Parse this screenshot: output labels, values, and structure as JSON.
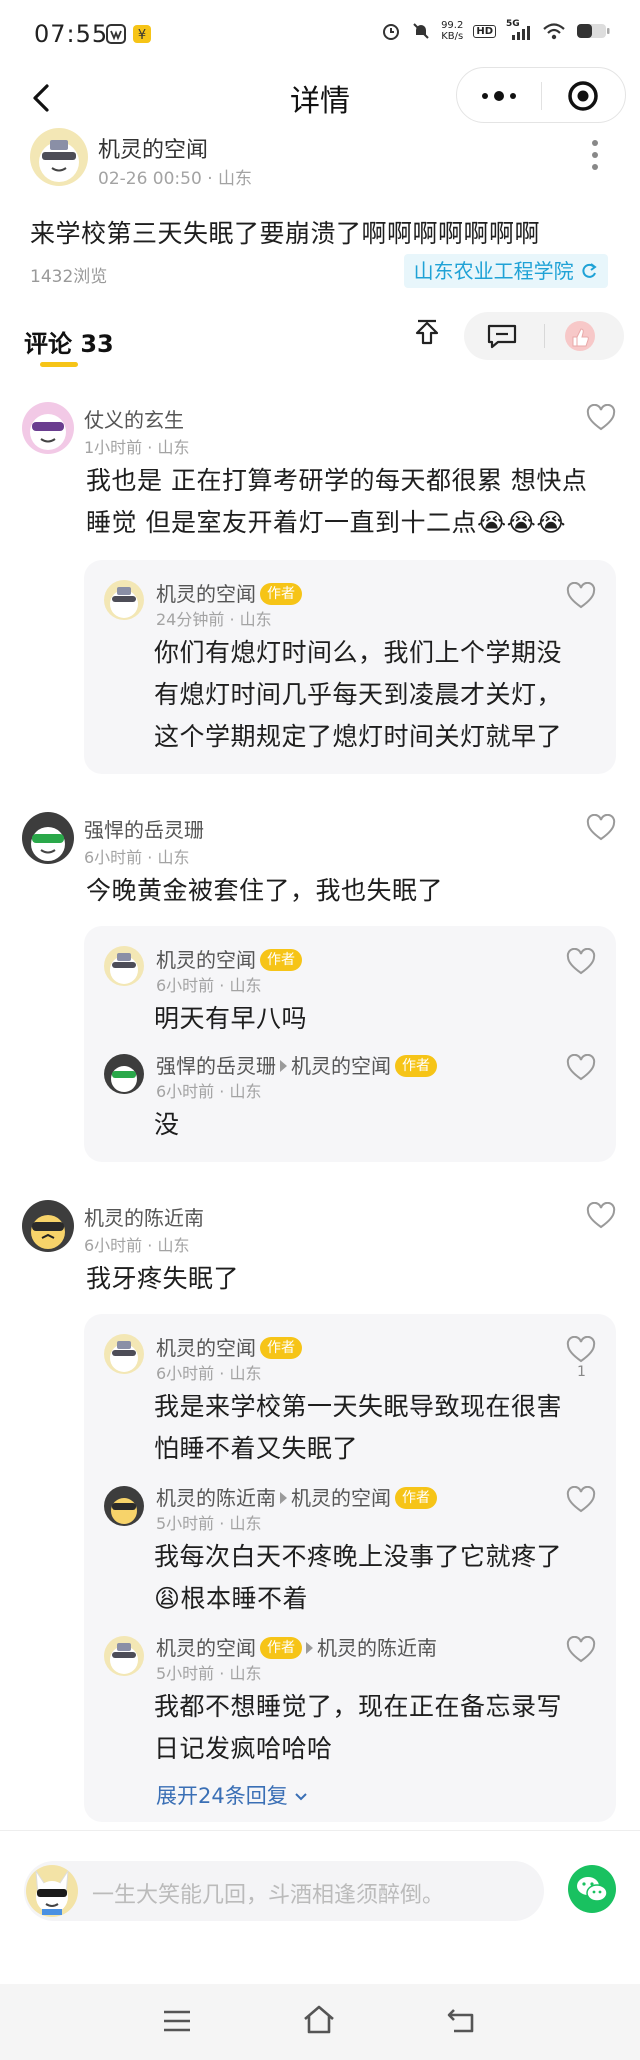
{
  "status_bar": {
    "time": "07:55",
    "net_speed_top": "99.2",
    "net_speed_bottom": "KB/s",
    "hd": "HD",
    "signal": "5G"
  },
  "nav": {
    "title": "详情"
  },
  "post": {
    "author": "机灵的空闻",
    "time": "02-26 00:50",
    "location": "山东",
    "content": "来学校第三天失眠了要崩溃了啊啊啊啊啊啊啊",
    "views": "1432浏览",
    "school_tag": "山东农业工程学院"
  },
  "comments_header": {
    "title": "评论 33"
  },
  "comments": [
    {
      "author": "仗义的玄生",
      "time": "1小时前",
      "location": "山东",
      "lines": [
        "我也是 正在打算考研学的每天都很累 想快点",
        "睡觉 但是室友开着灯一直到十二点😭😭😭"
      ],
      "replies": [
        {
          "author": "机灵的空闻",
          "badge": "作者",
          "time": "24分钟前",
          "location": "山东",
          "lines": [
            "你们有熄灯时间么，我们上个学期没",
            "有熄灯时间几乎每天到凌晨才关灯，",
            "这个学期规定了熄灯时间关灯就早了"
          ]
        }
      ]
    },
    {
      "author": "强悍的岳灵珊",
      "time": "6小时前",
      "location": "山东",
      "lines": [
        "今晚黄金被套住了，我也失眠了"
      ],
      "replies": [
        {
          "author": "机灵的空闻",
          "badge": "作者",
          "time": "6小时前",
          "location": "山东",
          "lines": [
            "明天有早八吗"
          ]
        },
        {
          "author": "强悍的岳灵珊",
          "reply_to": "机灵的空闻",
          "reply_to_badge": "作者",
          "time": "6小时前",
          "location": "山东",
          "lines": [
            "没"
          ]
        }
      ]
    },
    {
      "author": "机灵的陈近南",
      "time": "6小时前",
      "location": "山东",
      "lines": [
        "我牙疼失眠了"
      ],
      "replies": [
        {
          "author": "机灵的空闻",
          "badge": "作者",
          "time": "6小时前",
          "location": "山东",
          "like_count": "1",
          "lines": [
            "我是来学校第一天失眠导致现在很害",
            "怕睡不着又失眠了"
          ]
        },
        {
          "author": "机灵的陈近南",
          "reply_to": "机灵的空闻",
          "reply_to_badge": "作者",
          "time": "5小时前",
          "location": "山东",
          "lines": [
            "我每次白天不疼晚上没事了它就疼了",
            "😩根本睡不着"
          ]
        },
        {
          "author": "机灵的空闻",
          "badge": "作者",
          "reply_to": "机灵的陈近南",
          "time": "5小时前",
          "location": "山东",
          "lines": [
            "我都不想睡觉了，现在正在备忘录写",
            "日记发疯哈哈哈"
          ]
        }
      ],
      "expand": "展开24条回复"
    }
  ],
  "input": {
    "placeholder": "一生大笑能几回，斗酒相逢须醉倒。"
  },
  "colors": {
    "accent_yellow": "#f6c417",
    "link_blue": "#3a6fb5",
    "school_blue": "#1fa2d6",
    "wechat_green": "#19c160"
  },
  "icons": [
    "back-icon",
    "more-icon",
    "target-icon",
    "share-up-icon",
    "comment-icon",
    "heart-icon",
    "wechat-icon",
    "menu-icon",
    "home-icon",
    "return-icon"
  ]
}
